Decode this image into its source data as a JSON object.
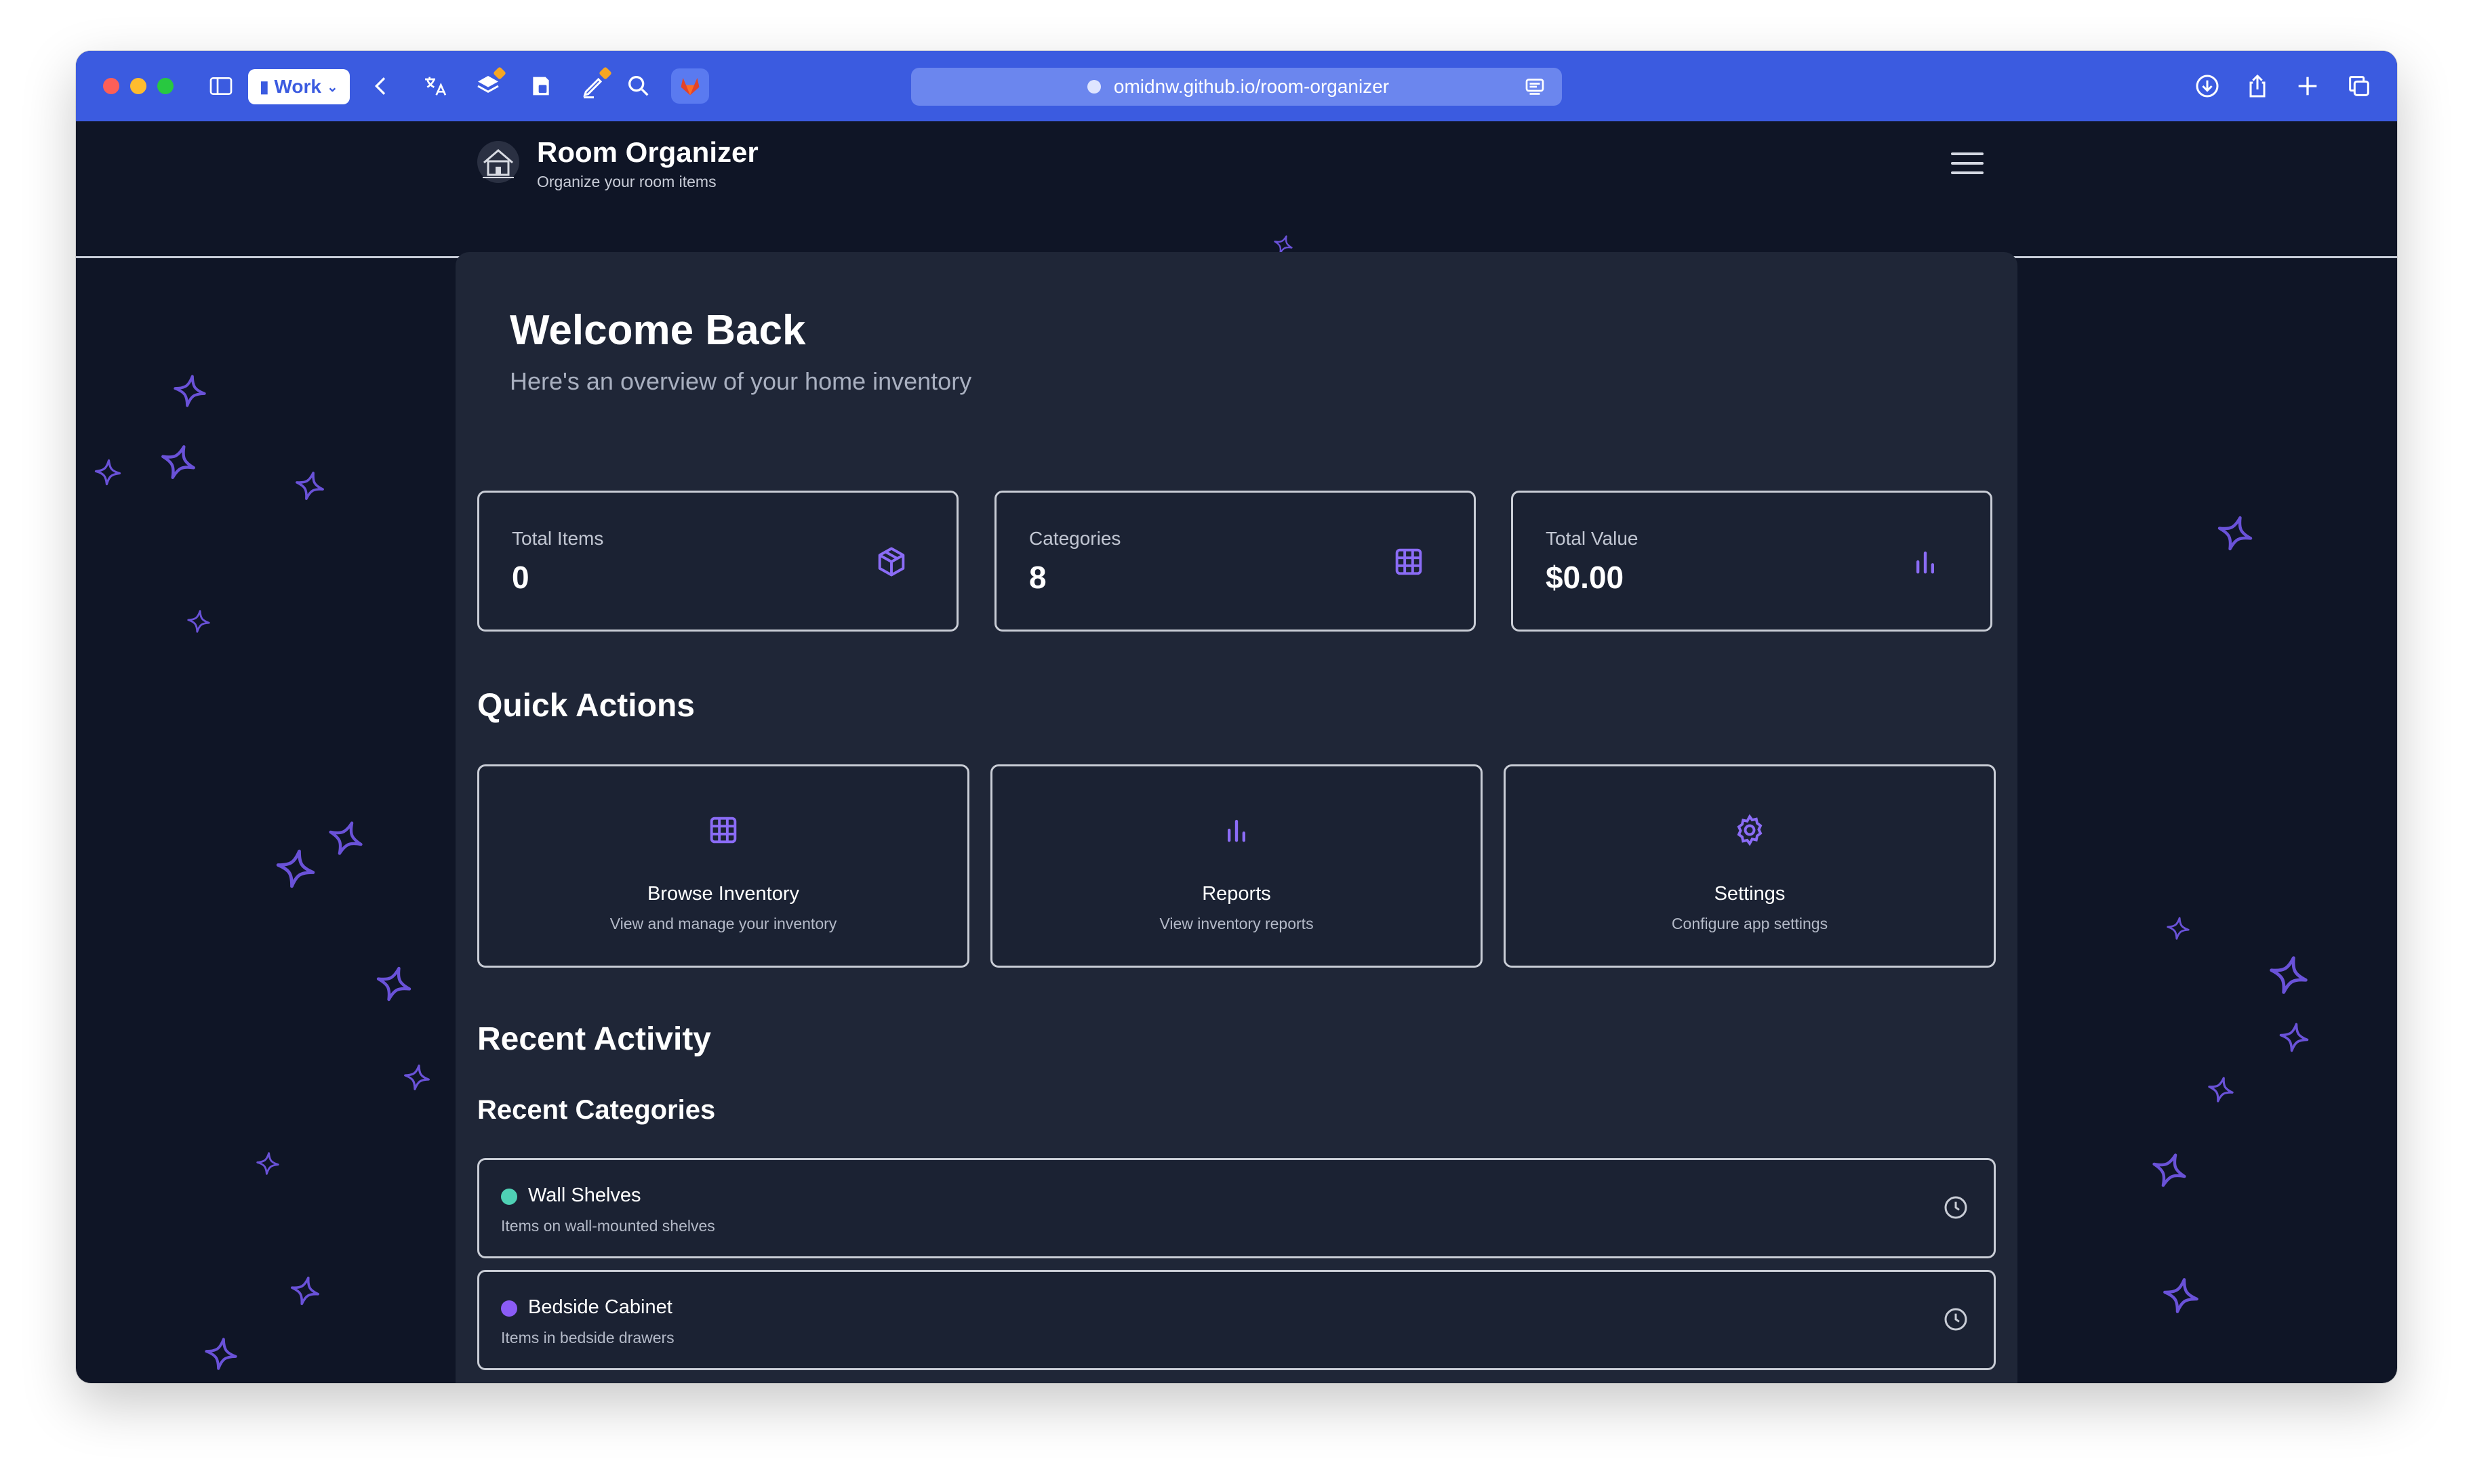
{
  "browser": {
    "profile_label": "Work",
    "url": "omidnw.github.io/room-organizer"
  },
  "header": {
    "title": "Room Organizer",
    "subtitle": "Organize your room items",
    "logo_icon": "house-logo-icon",
    "menu_icon": "hamburger-menu-icon"
  },
  "welcome": {
    "title": "Welcome Back",
    "subtitle": "Here's an overview of your home inventory"
  },
  "stats": [
    {
      "label": "Total Items",
      "value": "0",
      "icon": "cube-icon"
    },
    {
      "label": "Categories",
      "value": "8",
      "icon": "grid-icon"
    },
    {
      "label": "Total Value",
      "value": "$0.00",
      "icon": "bar-chart-icon"
    }
  ],
  "quick_actions": {
    "title": "Quick Actions",
    "items": [
      {
        "title": "Browse Inventory",
        "description": "View and manage your inventory",
        "icon": "grid-icon"
      },
      {
        "title": "Reports",
        "description": "View inventory reports",
        "icon": "bar-chart-icon"
      },
      {
        "title": "Settings",
        "description": "Configure app settings",
        "icon": "gear-icon"
      }
    ]
  },
  "recent_activity": {
    "title": "Recent Activity",
    "categories_title": "Recent Categories",
    "categories": [
      {
        "name": "Wall Shelves",
        "description": "Items on wall-mounted shelves",
        "color": "#4fd1b5"
      },
      {
        "name": "Bedside Cabinet",
        "description": "Items in bedside drawers",
        "color": "#8b5cf6"
      }
    ]
  },
  "colors": {
    "browser_accent": "#3b5be0",
    "background": "#0f1526",
    "card": "#1f2637",
    "accent_purple": "#7c5cf0"
  }
}
